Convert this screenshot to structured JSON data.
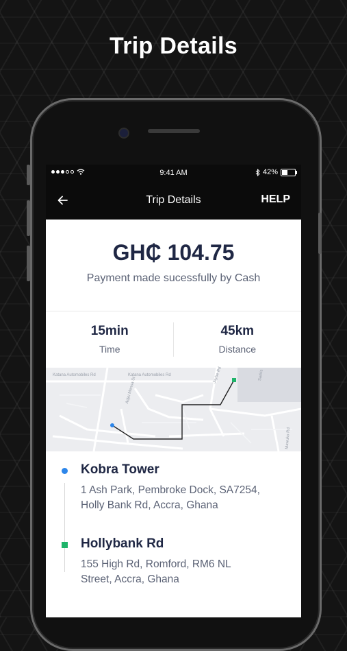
{
  "promo": {
    "title": "Trip Details"
  },
  "status_bar": {
    "time": "9:41 AM",
    "battery": "42%",
    "battery_level": 0.42
  },
  "nav": {
    "title": "Trip Details",
    "help_label": "HELP"
  },
  "fare": {
    "amount": "GH₵ 104.75",
    "message": "Payment made sucessfully by Cash"
  },
  "stats": {
    "time": {
      "value": "15min",
      "label": "Time"
    },
    "distance": {
      "value": "45km",
      "label": "Distance"
    }
  },
  "map": {
    "road_labels": [
      "Katana Automobiles Rd",
      "Katana Automobiles Rd",
      "Adjei Mensa St",
      "Jaybe Rd",
      "Sarkis",
      "Mawuko Rd"
    ]
  },
  "route": {
    "pickup": {
      "name": "Kobra Tower",
      "address": "1 Ash Park, Pembroke Dock, SA7254, Holly Bank Rd, Accra, Ghana"
    },
    "dropoff": {
      "name": "Hollybank Rd",
      "address": "155 High Rd, Romford, RM6 NL Street, Accra, Ghana"
    }
  },
  "colors": {
    "accent_blue": "#2d86ea",
    "accent_green": "#1fb46a",
    "text_dark": "#1f2744"
  }
}
